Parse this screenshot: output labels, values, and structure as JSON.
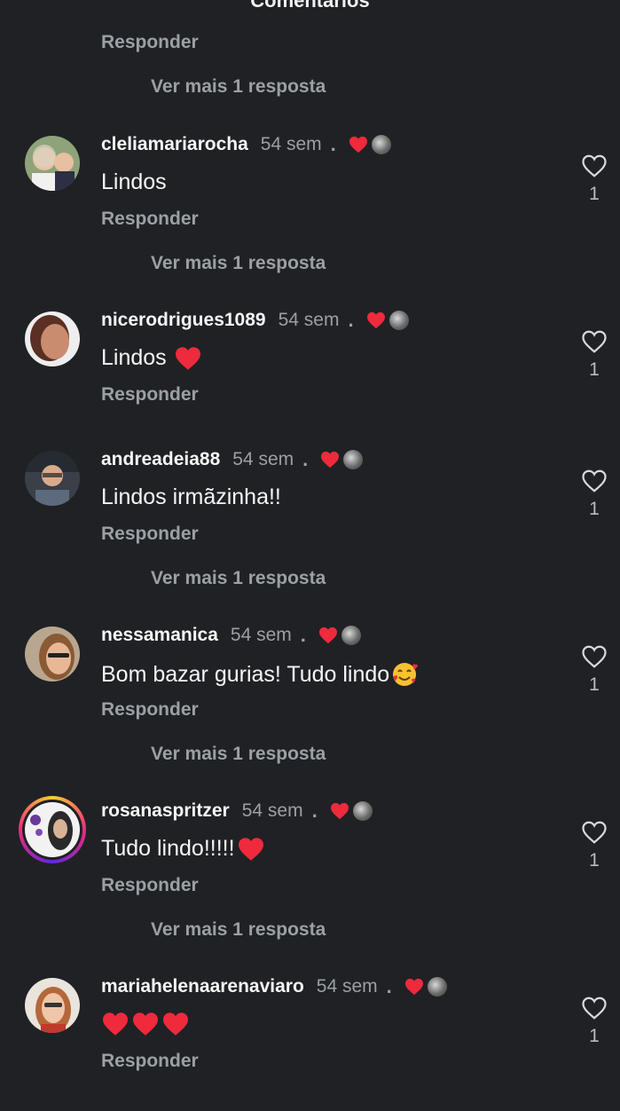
{
  "header": {
    "title": "Comentários"
  },
  "top": {
    "reply_label": "Responder",
    "more_replies": "Ver mais 1 resposta"
  },
  "comments": [
    {
      "username": "cleliamariarocha",
      "time": "54 sem",
      "dot": ".",
      "text": "Lindos",
      "reply_label": "Responder",
      "more_replies": "Ver mais 1 resposta",
      "likes": "1"
    },
    {
      "username": "nicerodrigues1089",
      "time": "54 sem",
      "dot": ".",
      "text": "Lindos",
      "reply_label": "Responder",
      "more_replies": "",
      "likes": "1"
    },
    {
      "username": "andreadeia88",
      "time": "54 sem",
      "dot": ".",
      "text": "Lindos irmãzinha!!",
      "reply_label": "Responder",
      "more_replies": "Ver mais 1 resposta",
      "likes": "1"
    },
    {
      "username": "nessamanica",
      "time": "54 sem",
      "dot": ".",
      "text": "Bom bazar gurias! Tudo lindo",
      "reply_label": "Responder",
      "more_replies": "Ver mais 1 resposta",
      "likes": "1"
    },
    {
      "username": "rosanaspritzer",
      "time": "54 sem",
      "dot": ".",
      "text": "Tudo lindo!!!!!",
      "reply_label": "Responder",
      "more_replies": "Ver mais 1 resposta",
      "likes": "1"
    },
    {
      "username": "mariahelenaarenaviaro",
      "time": "54 sem",
      "dot": ".",
      "text": "",
      "reply_label": "Responder",
      "more_replies": "",
      "likes": "1"
    }
  ],
  "colors": {
    "background": "#202124",
    "heart": "#ee2a3c",
    "muted": "#9aa0a6"
  },
  "icons": {
    "like": "heart-outline-icon",
    "creator_liked": "red-heart-icon"
  }
}
